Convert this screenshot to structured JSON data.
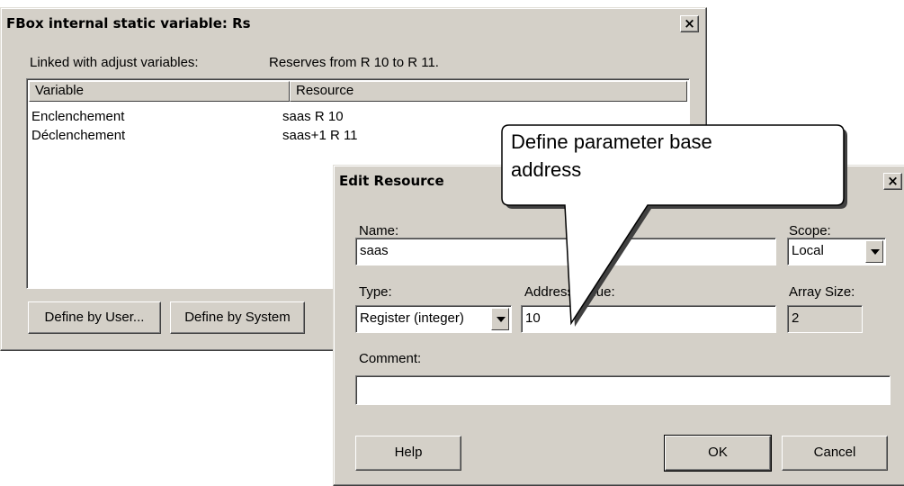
{
  "fbox_dialog": {
    "title": "FBox internal static variable: Rs",
    "close_label": "×",
    "linked_label": "Linked with adjust variables:",
    "reserves_text": "Reserves from R 10 to R 11.",
    "columns": [
      "Variable",
      "Resource"
    ],
    "rows": [
      {
        "variable": "Enclenchement",
        "resource": "saas  R 10"
      },
      {
        "variable": "Déclenchement",
        "resource": "saas+1  R 11"
      }
    ],
    "define_user_label": "Define by User...",
    "define_system_label": "Define by System"
  },
  "edit_dialog": {
    "title": "Edit Resource",
    "close_label": "×",
    "name_label": "Name:",
    "name_value": "saas",
    "scope_label": "Scope:",
    "scope_value": "Local",
    "type_label": "Type:",
    "type_value": "Register (integer)",
    "address_label": "Address/Value:",
    "address_value": "10",
    "array_size_label": "Array Size:",
    "array_size_value": "2",
    "comment_label": "Comment:",
    "comment_value": "",
    "help_label": "Help",
    "ok_label": "OK",
    "cancel_label": "Cancel"
  },
  "callout": {
    "line1": "Define parameter base",
    "line2": "address"
  }
}
